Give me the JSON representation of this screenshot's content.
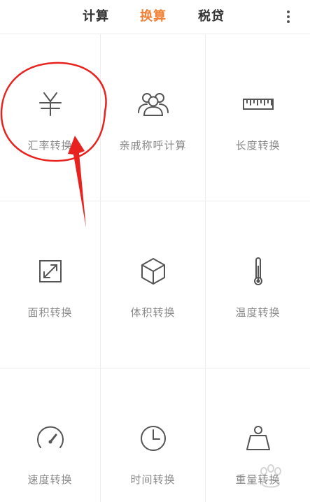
{
  "tabs": [
    {
      "label": "计算",
      "active": false
    },
    {
      "label": "换算",
      "active": true
    },
    {
      "label": "税贷",
      "active": false
    }
  ],
  "colors": {
    "accent": "#f08137",
    "text": "#333333",
    "label": "#888888",
    "annotation": "#e8231f"
  },
  "grid": {
    "items": [
      {
        "label": "汇率转换",
        "icon": "yuan-icon"
      },
      {
        "label": "亲戚称呼计算",
        "icon": "people-icon"
      },
      {
        "label": "长度转换",
        "icon": "ruler-icon"
      },
      {
        "label": "面积转换",
        "icon": "expand-icon"
      },
      {
        "label": "体积转换",
        "icon": "cube-icon"
      },
      {
        "label": "温度转换",
        "icon": "thermometer-icon"
      },
      {
        "label": "速度转换",
        "icon": "speedometer-icon"
      },
      {
        "label": "时间转换",
        "icon": "clock-icon"
      },
      {
        "label": "重量转换",
        "icon": "weight-icon"
      }
    ]
  }
}
